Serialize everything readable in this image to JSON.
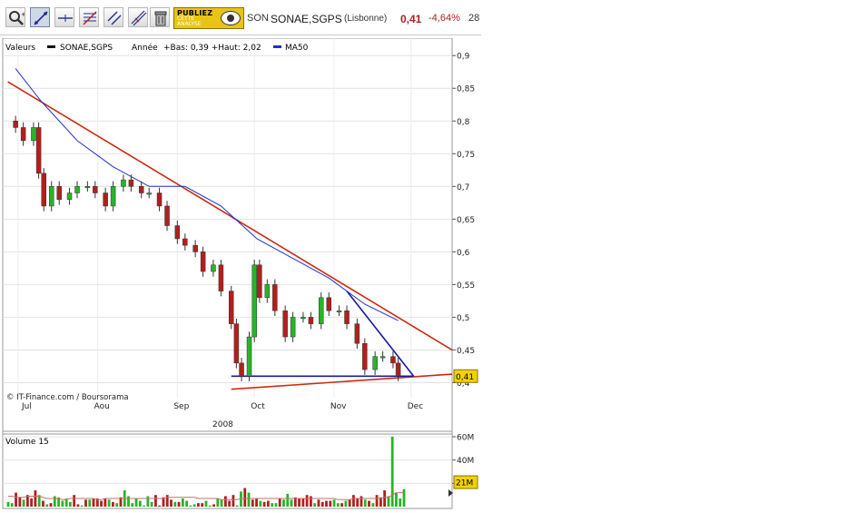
{
  "toolbar": {
    "tools": [
      {
        "name": "zoom-tool-button",
        "icon": "zoom-icon"
      },
      {
        "name": "trendline-tool-button",
        "icon": "trendline-icon"
      },
      {
        "name": "horizontal-line-tool-button",
        "icon": "horizontal-line-icon"
      },
      {
        "name": "fibonacci-tool-button",
        "icon": "fibonacci-icon"
      },
      {
        "name": "parallel-lines-tool-button",
        "icon": "parallel-lines-icon"
      },
      {
        "name": "channel-tool-button",
        "icon": "channel-icon"
      },
      {
        "name": "delete-tool-button",
        "icon": "trash-icon"
      }
    ],
    "ad": {
      "line1": "PUBLIEZ",
      "line2": "CETTE ANALYSE"
    },
    "symbol_code": "SON",
    "symbol_name": "SONAE,SGPS",
    "market": "(Lisbonne)",
    "last_price": "0,41",
    "change": "-4,64%",
    "extra": "28"
  },
  "chart_data": [
    {
      "type": "candlestick",
      "legend": {
        "label": "Valeurs",
        "series_name": "SONAE,SGPS",
        "period": "Année",
        "low_high": "+Bas: 0,39 +Haut: 2,02",
        "ma_label": "MA50"
      },
      "y_ticks": [
        "0,9",
        "0,85",
        "0,8",
        "0,75",
        "0,7",
        "0,65",
        "0,6",
        "0,55",
        "0,5",
        "0,45",
        "0,4"
      ],
      "ylim": [
        0.384,
        0.91
      ],
      "x_ticks": [
        {
          "label": "Jul",
          "month": "2008-07"
        },
        {
          "label": "Aou",
          "month": "2008-08"
        },
        {
          "label": "Sep",
          "month": "2008-09"
        },
        {
          "label": "Oct",
          "month": "2008-10"
        },
        {
          "label": "Nov",
          "month": "2008-11"
        },
        {
          "label": "Dec",
          "month": "2008-12"
        }
      ],
      "year_label": "2008",
      "last_price_label": "0,41",
      "copyright": "© IT-Finance.com / Boursorama",
      "close_points": [
        [
          "2008-06-30",
          0.79
        ],
        [
          "2008-07-03",
          0.77
        ],
        [
          "2008-07-07",
          0.79
        ],
        [
          "2008-07-09",
          0.72
        ],
        [
          "2008-07-11",
          0.67
        ],
        [
          "2008-07-14",
          0.7
        ],
        [
          "2008-07-17",
          0.68
        ],
        [
          "2008-07-21",
          0.69
        ],
        [
          "2008-07-24",
          0.7
        ],
        [
          "2008-07-28",
          0.7
        ],
        [
          "2008-07-31",
          0.69
        ],
        [
          "2008-08-04",
          0.67
        ],
        [
          "2008-08-07",
          0.7
        ],
        [
          "2008-08-11",
          0.71
        ],
        [
          "2008-08-14",
          0.7
        ],
        [
          "2008-08-18",
          0.69
        ],
        [
          "2008-08-21",
          0.69
        ],
        [
          "2008-08-25",
          0.67
        ],
        [
          "2008-08-28",
          0.64
        ],
        [
          "2008-09-01",
          0.62
        ],
        [
          "2008-09-04",
          0.61
        ],
        [
          "2008-09-08",
          0.6
        ],
        [
          "2008-09-11",
          0.57
        ],
        [
          "2008-09-15",
          0.58
        ],
        [
          "2008-09-18",
          0.54
        ],
        [
          "2008-09-22",
          0.49
        ],
        [
          "2008-09-24",
          0.43
        ],
        [
          "2008-09-26",
          0.41
        ],
        [
          "2008-09-29",
          0.47
        ],
        [
          "2008-10-01",
          0.58
        ],
        [
          "2008-10-03",
          0.53
        ],
        [
          "2008-10-06",
          0.55
        ],
        [
          "2008-10-09",
          0.51
        ],
        [
          "2008-10-13",
          0.47
        ],
        [
          "2008-10-16",
          0.5
        ],
        [
          "2008-10-20",
          0.5
        ],
        [
          "2008-10-23",
          0.49
        ],
        [
          "2008-10-27",
          0.53
        ],
        [
          "2008-10-30",
          0.51
        ],
        [
          "2008-11-03",
          0.51
        ],
        [
          "2008-11-06",
          0.49
        ],
        [
          "2008-11-10",
          0.46
        ],
        [
          "2008-11-13",
          0.42
        ],
        [
          "2008-11-17",
          0.44
        ],
        [
          "2008-11-20",
          0.44
        ],
        [
          "2008-11-24",
          0.43
        ],
        [
          "2008-11-26",
          0.41
        ]
      ],
      "ma50_points": [
        [
          "2008-06-30",
          0.88
        ],
        [
          "2008-07-10",
          0.83
        ],
        [
          "2008-07-24",
          0.77
        ],
        [
          "2008-08-07",
          0.73
        ],
        [
          "2008-08-21",
          0.7
        ],
        [
          "2008-09-04",
          0.7
        ],
        [
          "2008-09-18",
          0.67
        ],
        [
          "2008-10-02",
          0.62
        ],
        [
          "2008-10-16",
          0.59
        ],
        [
          "2008-10-30",
          0.56
        ],
        [
          "2008-11-13",
          0.52
        ],
        [
          "2008-11-26",
          0.495
        ]
      ],
      "trendlines": [
        {
          "name": "long-term-resistance",
          "color": "#cc2a10",
          "from": [
            "2008-06-27",
            0.86
          ],
          "to": [
            "2008-12-17",
            0.45
          ]
        },
        {
          "name": "long-term-support",
          "color": "#cc2a10",
          "from": [
            "2008-09-22",
            0.39
          ],
          "to": [
            "2008-12-17",
            0.413
          ]
        },
        {
          "name": "triangle-upper",
          "color": "#1818a0",
          "from": [
            "2008-11-06",
            0.54
          ],
          "to": [
            "2008-12-02",
            0.41
          ]
        },
        {
          "name": "triangle-base",
          "color": "#1818a0",
          "from": [
            "2008-09-22",
            0.41
          ],
          "to": [
            "2008-12-02",
            0.41
          ]
        }
      ]
    },
    {
      "type": "bar",
      "title": "Volume 15",
      "y_ticks": [
        "60M",
        "40M",
        "20M"
      ],
      "ylim": [
        0,
        60
      ],
      "unit": "M",
      "last_label": "21M",
      "values_m": [
        4,
        3,
        12,
        8,
        6,
        10,
        7,
        14,
        10,
        5,
        2,
        3,
        9,
        8,
        5,
        7,
        4,
        10,
        2,
        1,
        6,
        6,
        7,
        7,
        5,
        7,
        6,
        4,
        3,
        8,
        14,
        9,
        3,
        7,
        5,
        1,
        9,
        4,
        10,
        1,
        8,
        10,
        6,
        4,
        4,
        7,
        5,
        1,
        2,
        3,
        3,
        5,
        1,
        2,
        7,
        6,
        9,
        5,
        10,
        1,
        13,
        16,
        12,
        6,
        7,
        5,
        4,
        5,
        3,
        3,
        7,
        6,
        11,
        6,
        8,
        7,
        7,
        10,
        9,
        3,
        6,
        4,
        5,
        5,
        6,
        3,
        3,
        5,
        6,
        10,
        7,
        9,
        6,
        5,
        3,
        10,
        8,
        14,
        9,
        60,
        12,
        7,
        15
      ],
      "ma_values_m": [
        9,
        9,
        8,
        8,
        8,
        9,
        9,
        9,
        9,
        8,
        7,
        7,
        7,
        7,
        6,
        6,
        7,
        7,
        7,
        7,
        7,
        7,
        7,
        6,
        6,
        7,
        7,
        7,
        7,
        7,
        7,
        7,
        7,
        7,
        7,
        7,
        7,
        7,
        7,
        7,
        7,
        8,
        8,
        8,
        8,
        8,
        8,
        8,
        8,
        7,
        7,
        7,
        7,
        7,
        7,
        6,
        6,
        6,
        6,
        6,
        7,
        7,
        7,
        7,
        7,
        7,
        7,
        7,
        7,
        7,
        7,
        7,
        7,
        7,
        7,
        7,
        7,
        7,
        7,
        7,
        7,
        7,
        7,
        7,
        7,
        6,
        6,
        6,
        6,
        7,
        7,
        7,
        7,
        7,
        7,
        7,
        7,
        8,
        8,
        10,
        12,
        12,
        12
      ]
    }
  ],
  "colors": {
    "up": "#26b526",
    "down": "#b0201c",
    "ma": "#2030c8",
    "resistance": "#cc2a10",
    "triangle": "#1818a0",
    "price_badge": "#f2d200"
  }
}
